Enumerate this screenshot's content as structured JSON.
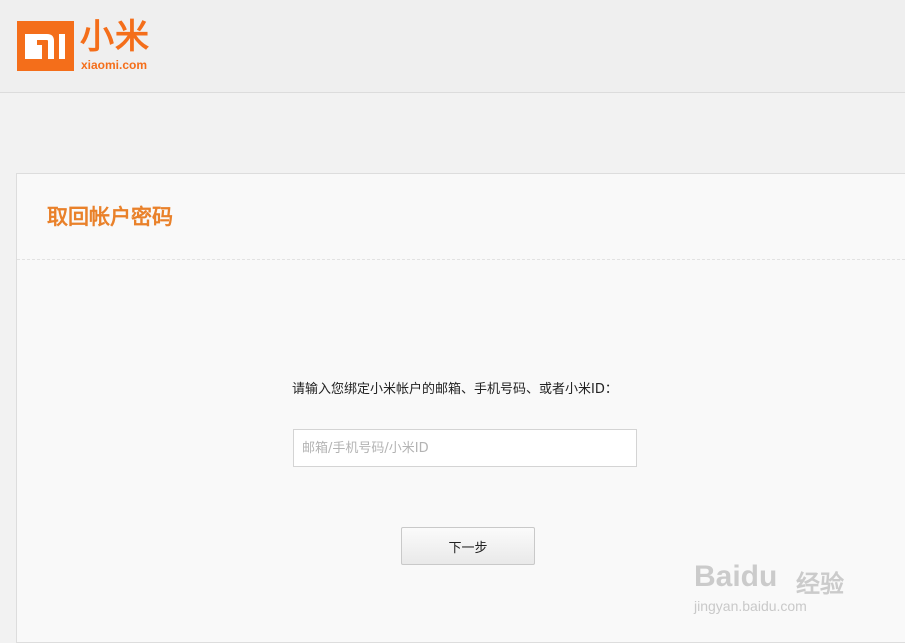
{
  "header": {
    "logo_text": "小米",
    "logo_url": "xiaomi.com",
    "brand_color": "#f46e1a"
  },
  "card": {
    "title": "取回帐户密码",
    "instruction": "请输入您绑定小米帐户的邮箱、手机号码、或者小米ID：",
    "account_input": {
      "value": "",
      "placeholder": "邮箱/手机号码/小米ID"
    },
    "next_button_label": "下一步",
    "title_color": "#e9812a"
  },
  "watermark": {
    "text": "Baidu",
    "cn": "经验",
    "url": "jingyan.baidu.com"
  }
}
